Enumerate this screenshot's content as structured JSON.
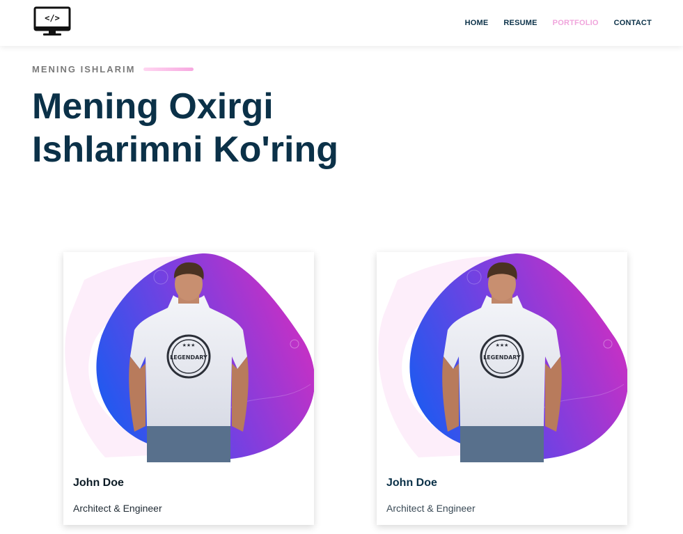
{
  "header": {
    "logo_icon": "code-monitor-icon",
    "logo_text": "</>",
    "nav": [
      {
        "label": "HOME"
      },
      {
        "label": "RESUME"
      },
      {
        "label": "PORTFOLIO",
        "active": true
      },
      {
        "label": "CONTACT"
      }
    ],
    "active_color": "#f0a5dc"
  },
  "section": {
    "eyebrow": "MENING ISHLARIM",
    "title_line1": "Mening Oxirgi",
    "title_line2": "Ishlarimni Ko'ring"
  },
  "cards": [
    {
      "name": "John Doe",
      "role": "Architect & Engineer",
      "image_icon": "portrait-photo"
    },
    {
      "name": "John Doe",
      "role": "Architect & Engineer",
      "image_icon": "portrait-photo"
    }
  ],
  "colors": {
    "heading": "#0b3148",
    "blob_start": "#1e5af0",
    "blob_end": "#d22ec0",
    "blob_bg": "#fdeefa"
  }
}
